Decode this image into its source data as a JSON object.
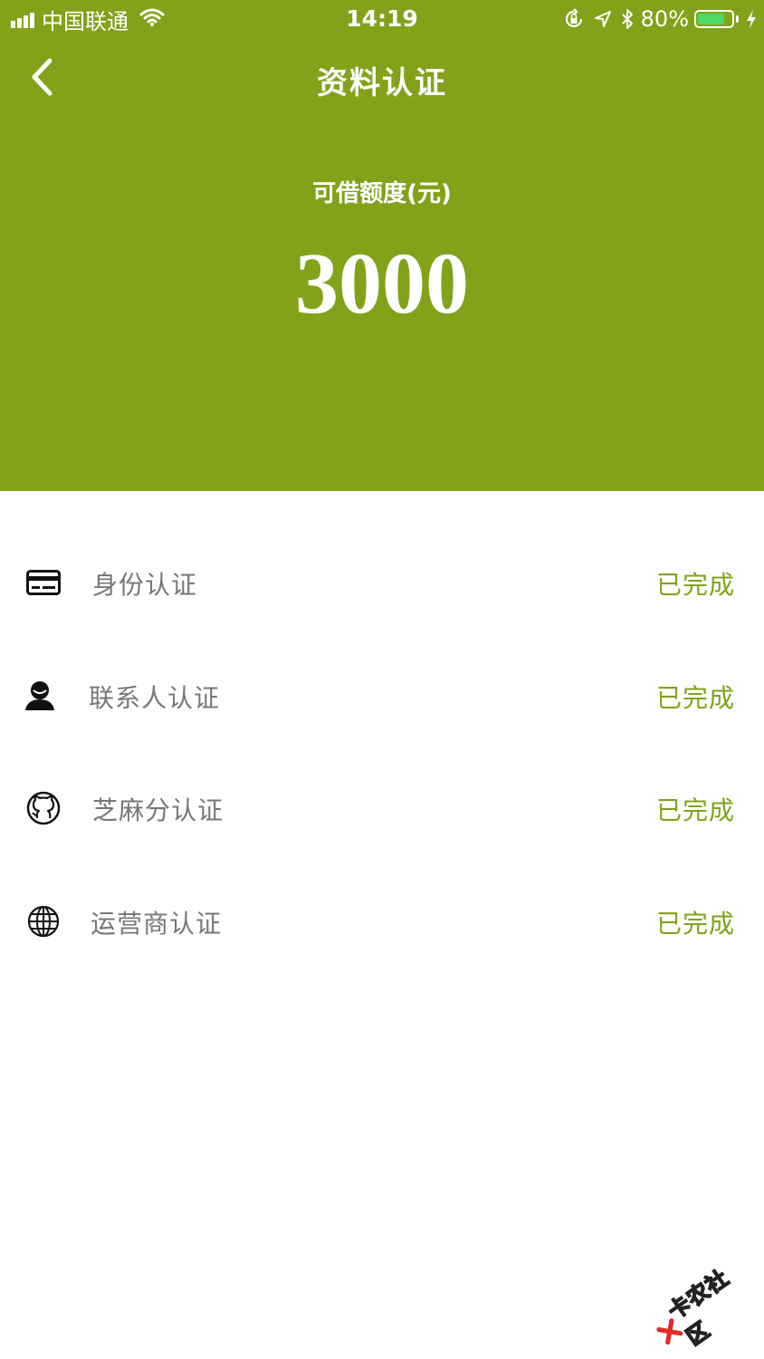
{
  "status_bar": {
    "carrier": "中国联通",
    "time": "14:19",
    "battery_percent": "80%",
    "battery_level": 0.8,
    "battery_color": "#4cd964"
  },
  "nav": {
    "title": "资料认证",
    "back_icon": "chevron-left-icon"
  },
  "credit": {
    "label": "可借额度(元)",
    "amount": "3000"
  },
  "colors": {
    "brand": "#82a21a",
    "label_gray": "#777777",
    "background": "#ffffff"
  },
  "verifications": [
    {
      "icon": "id-card-icon",
      "label": "身份认证",
      "status": "已完成"
    },
    {
      "icon": "contact-person-icon",
      "label": "联系人认证",
      "status": "已完成"
    },
    {
      "icon": "github-icon",
      "label": "芝麻分认证",
      "status": "已完成"
    },
    {
      "icon": "globe-icon",
      "label": "运营商认证",
      "status": "已完成"
    }
  ],
  "watermark": {
    "text": "卡农社区"
  }
}
